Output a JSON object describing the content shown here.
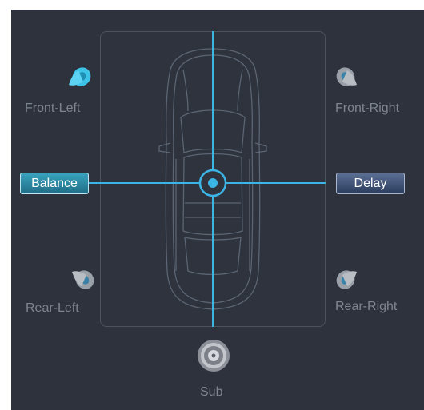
{
  "speakers": {
    "front_left": {
      "label": "Front-Left",
      "active": true,
      "icon": "speaker-icon"
    },
    "front_right": {
      "label": "Front-Right",
      "active": false,
      "icon": "speaker-icon"
    },
    "rear_left": {
      "label": "Rear-Left",
      "active": false,
      "icon": "speaker-icon"
    },
    "rear_right": {
      "label": "Rear-Right",
      "active": false,
      "icon": "speaker-icon"
    },
    "sub": {
      "label": "Sub",
      "icon": "subwoofer-icon"
    }
  },
  "buttons": {
    "balance": "Balance",
    "delay": "Delay"
  },
  "colors": {
    "accent": "#3cb4e6",
    "panel_bg": "#2d323c",
    "label": "#7f8590"
  }
}
